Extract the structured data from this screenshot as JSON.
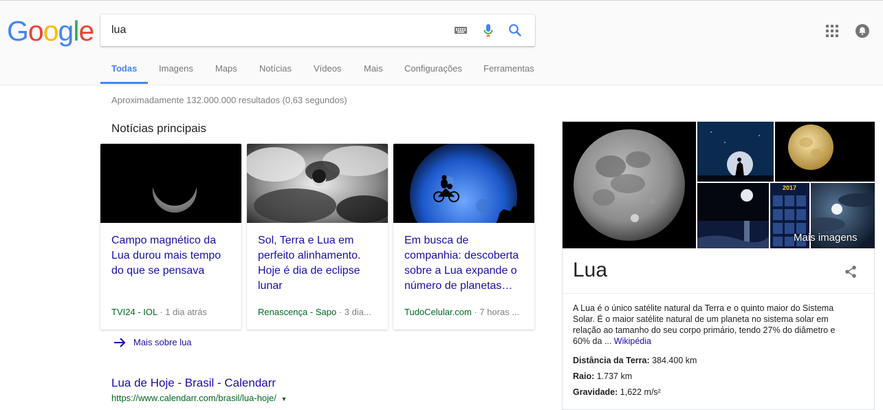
{
  "search": {
    "query": "lua"
  },
  "logo": {
    "text": "Google"
  },
  "tabs": [
    {
      "label": "Todas"
    },
    {
      "label": "Imagens"
    },
    {
      "label": "Maps"
    },
    {
      "label": "Notícias"
    },
    {
      "label": "Vídeos"
    },
    {
      "label": "Mais"
    },
    {
      "label": "Configurações"
    },
    {
      "label": "Ferramentas"
    }
  ],
  "results_stats": "Aproximadamente 132.000.000 resultados (0,63 segundos)",
  "top_news": {
    "heading": "Notícias principais",
    "cards": [
      {
        "title": "Campo magnético da Lua durou mais tempo do que se pensava",
        "source": "TVI24 - IOL",
        "time": " · 1 dia atrás"
      },
      {
        "title": "Sol, Terra e Lua em perfeito alinhamento. Hoje é dia de eclipse lunar",
        "source": "Renascença - Sapo",
        "time": " · 3 dia..."
      },
      {
        "title": "Em busca de companhia: descoberta sobre a Lua expande o número de planetas…",
        "source": "TudoCelular.com",
        "time": " · 7 horas ..."
      }
    ],
    "more_link": "Mais sobre lua"
  },
  "result": {
    "title": "Lua de Hoje - Brasil - Calendarr",
    "url": "https://www.calendarr.com/brasil/lua-hoje/"
  },
  "knowledge_panel": {
    "more_images": "Mais imagens",
    "title": "Lua",
    "description": "A Lua é o único satélite natural da Terra e o quinto maior do Sistema Solar. É o maior satélite natural de um planeta no sistema solar em relação ao tamanho do seu corpo primário, tendo 27% do diâmetro e 60% da ...",
    "source_link": "Wikipédia",
    "calendar_year": "2017",
    "facts": [
      {
        "label": "Distância da Terra:",
        "value": " 384.400 km"
      },
      {
        "label": "Raio:",
        "value": " 1.737 km"
      },
      {
        "label": "Gravidade:",
        "value": " 1,622 m/s²"
      }
    ]
  },
  "colors": {
    "link": "#1a0dab",
    "url_green": "#006621",
    "accent_blue": "#4285f4"
  }
}
